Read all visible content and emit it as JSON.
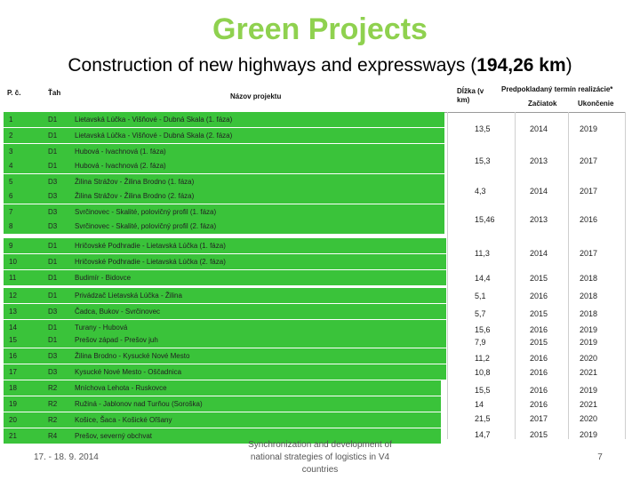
{
  "title": "Green Projects",
  "subtitle_prefix": "Construction of new highways and expressways (",
  "subtitle_bold": "194,26 km",
  "subtitle_suffix": ")",
  "table": {
    "headers": {
      "no": "P. č.",
      "road": "Ťah",
      "name": "Názov projektu",
      "length": "Dĺžka (v km)",
      "term": "Predpokladaný termín realizácie*",
      "start": "Začiatok",
      "end": "Ukončenie"
    },
    "rows": [
      {
        "no": "1",
        "road": "D1",
        "name": "Lietavská Lúčka - Višňové - Dubná Skala (1. fáza)"
      },
      {
        "no": "2",
        "road": "D1",
        "name": "Lietavská Lúčka - Višňové - Dubná Skala (2. fáza)"
      },
      {
        "no": "3",
        "road": "D1",
        "name": "Hubová - Ivachnová (1. fáza)"
      },
      {
        "no": "4",
        "road": "D1",
        "name": "Hubová - Ivachnová (2. fáza)"
      },
      {
        "no": "5",
        "road": "D3",
        "name": "Žilina Strážov - Žilina Brodno (1. fáza)"
      },
      {
        "no": "6",
        "road": "D3",
        "name": "Žilina Strážov - Žilina Brodno (2. fáza)"
      },
      {
        "no": "7",
        "road": "D3",
        "name": "Svrčinovec - Skalité, polovičný profil (1. fáza)"
      },
      {
        "no": "8",
        "road": "D3",
        "name": "Svrčinovec - Skalité, polovičný profil (2. fáza)"
      },
      {
        "no": "9",
        "road": "D1",
        "name": "Hričovské Podhradie - Lietavská Lúčka (1. fáza)"
      },
      {
        "no": "10",
        "road": "D1",
        "name": "Hričovské Podhradie - Lietavská Lúčka (2. fáza)"
      },
      {
        "no": "11",
        "road": "D1",
        "name": "Budimír - Bidovce"
      },
      {
        "no": "12",
        "road": "D1",
        "name": "Privádzač Lietavská Lúčka - Žilina"
      },
      {
        "no": "13",
        "road": "D3",
        "name": "Čadca, Bukov - Svrčinovec"
      },
      {
        "no": "14",
        "road": "D1",
        "name": "Turany - Hubová"
      },
      {
        "no": "15",
        "road": "D1",
        "name": "Prešov západ - Prešov juh"
      },
      {
        "no": "16",
        "road": "D3",
        "name": "Žilina Brodno - Kysucké Nové Mesto"
      },
      {
        "no": "17",
        "road": "D3",
        "name": "Kysucké Nové Mesto - Oščadnica"
      },
      {
        "no": "18",
        "road": "R2",
        "name": "Mníchova Lehota - Ruskovce"
      },
      {
        "no": "19",
        "road": "R2",
        "name": "Ružiná - Jablonov nad Turňou (Soroška)"
      },
      {
        "no": "20",
        "road": "R2",
        "name": "Košice, Šaca - Košické Oľšany"
      },
      {
        "no": "21",
        "road": "R4",
        "name": "Prešov, severný obchvat"
      }
    ],
    "values": [
      {
        "length": "13,5",
        "start": "2014",
        "end": "2019"
      },
      {
        "length": "15,3",
        "start": "2013",
        "end": "2017"
      },
      {
        "length": "4,3",
        "start": "2014",
        "end": "2017"
      },
      {
        "length": "15,46",
        "start": "2013",
        "end": "2016"
      },
      {
        "length": "11,3",
        "start": "2014",
        "end": "2017"
      },
      {
        "length": "14,4",
        "start": "2015",
        "end": "2018"
      },
      {
        "length": "5,1",
        "start": "2016",
        "end": "2018"
      },
      {
        "length": "5,7",
        "start": "2015",
        "end": "2018"
      },
      {
        "length": "15,6",
        "start": "2016",
        "end": "2019"
      },
      {
        "length": "7,9",
        "start": "2015",
        "end": "2019"
      },
      {
        "length": "11,2",
        "start": "2016",
        "end": "2020"
      },
      {
        "length": "10,8",
        "start": "2016",
        "end": "2021"
      },
      {
        "length": "15,5",
        "start": "2016",
        "end": "2019"
      },
      {
        "length": "14",
        "start": "2016",
        "end": "2021"
      },
      {
        "length": "21,5",
        "start": "2017",
        "end": "2020"
      },
      {
        "length": "14,7",
        "start": "2015",
        "end": "2019"
      }
    ]
  },
  "footer": {
    "date": "17. - 18. 9. 2014",
    "center": "Synchronization and development of national strategies of logistics in V4 countries",
    "page": "7"
  },
  "colors": {
    "title": "#8fd14f",
    "row_fill": "#3ac33a"
  }
}
